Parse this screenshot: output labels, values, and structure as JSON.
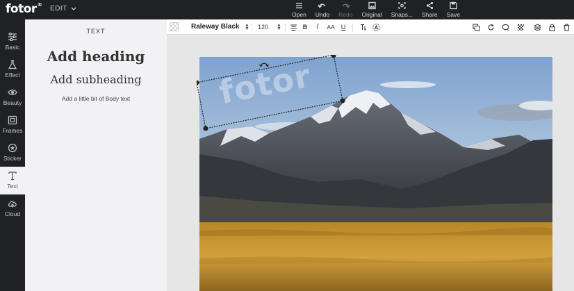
{
  "app": {
    "logo": "fotor",
    "logo_mark": "®",
    "edit_menu": "EDIT"
  },
  "toolbar": {
    "items": [
      {
        "label": "Open",
        "icon": "hamburger-icon",
        "enabled": true
      },
      {
        "label": "Undo",
        "icon": "undo-icon",
        "enabled": true
      },
      {
        "label": "Redo",
        "icon": "redo-icon",
        "enabled": false
      },
      {
        "label": "Original",
        "icon": "image-icon",
        "enabled": true
      },
      {
        "label": "Snaps...",
        "icon": "snapshot-icon",
        "enabled": true
      },
      {
        "label": "Share",
        "icon": "share-icon",
        "enabled": true
      },
      {
        "label": "Save",
        "icon": "save-icon",
        "enabled": true
      }
    ]
  },
  "leftnav": {
    "items": [
      {
        "label": "Basic",
        "icon": "sliders-icon",
        "active": false
      },
      {
        "label": "Effect",
        "icon": "flask-icon",
        "active": false
      },
      {
        "label": "Beauty",
        "icon": "eye-icon",
        "active": false
      },
      {
        "label": "Frames",
        "icon": "frame-icon",
        "active": false
      },
      {
        "label": "Sticker",
        "icon": "sticker-icon",
        "active": false
      },
      {
        "label": "Text",
        "icon": "text-T-icon",
        "active": true
      },
      {
        "label": "Cloud",
        "icon": "cloud-icon",
        "active": false
      }
    ]
  },
  "text_panel": {
    "title": "TEXT",
    "heading": "Add heading",
    "subheading": "Add subheading",
    "body": "Add a little bit of Body text"
  },
  "text_toolbar": {
    "font_family": "Raleway Black",
    "font_size": "120",
    "bold": "B",
    "italic": "I",
    "case": "AA",
    "underline": "U"
  },
  "canvas": {
    "watermark_text": "fotor"
  },
  "colors": {
    "topbar_bg": "#1f2124",
    "panel_bg": "#f2f2f4",
    "canvas_bg": "#e6e6e6"
  }
}
